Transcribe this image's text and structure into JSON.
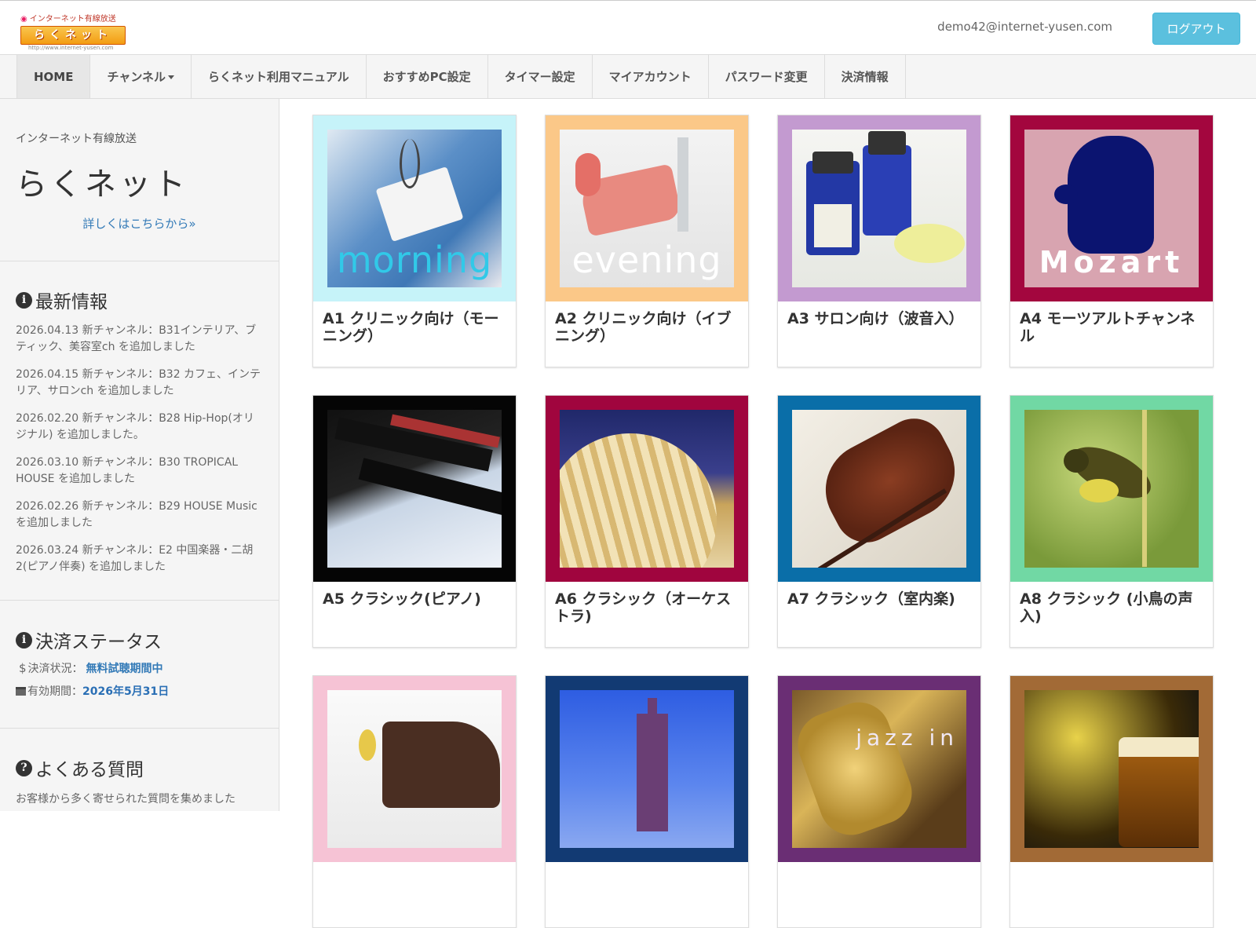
{
  "header": {
    "logo_top": "インターネット有線放送",
    "logo_main": "らくネット",
    "logo_url": "http://www.internet-yusen.com",
    "user_email": "demo42@internet-yusen.com",
    "logout_label": "ログアウト"
  },
  "nav": {
    "items": [
      {
        "label": "HOME"
      },
      {
        "label": "チャンネル"
      },
      {
        "label": "らくネット利用マニュアル"
      },
      {
        "label": "おすすめPC設定"
      },
      {
        "label": "タイマー設定"
      },
      {
        "label": "マイアカウント"
      },
      {
        "label": "パスワード変更"
      },
      {
        "label": "決済情報"
      }
    ]
  },
  "sidebar": {
    "intro_small": "インターネット有線放送",
    "brand": "らくネット",
    "more_link": "詳しくはこちらから»",
    "news_heading": "最新情報",
    "news": [
      "2026.04.13 新チャンネル：B31インテリア、ブティック、美容室ch を追加しました",
      "2026.04.15 新チャンネル：B32 カフェ、インテリア、サロンch を追加しました",
      "2026.02.20 新チャンネル：B28 Hip-Hop(オリジナル) を追加しました。",
      "2026.03.10 新チャンネル：B30 TROPICAL HOUSE を追加しました",
      "2026.02.26 新チャンネル：B29 HOUSE Music を追加しました",
      "2026.03.24 新チャンネル：E2 中国楽器・二胡2(ピアノ伴奏) を追加しました"
    ],
    "pay_heading": "決済ステータス",
    "pay_status_label": "決済状況：",
    "pay_status_value": "無料試聴期間中",
    "expiry_label": "有効期間：",
    "expiry_value": "2026年5月31日",
    "faq_heading": "よくある質問",
    "faq_text": "お客様から多く寄せられた質問を集めました"
  },
  "channels": [
    {
      "title": "A1 クリニック向け（モーニング）",
      "overlay": "morning",
      "frame_color": "#c6f3f9"
    },
    {
      "title": "A2 クリニック向け（イブニング）",
      "overlay": "evening",
      "frame_color": "#fbc888"
    },
    {
      "title": "A3 サロン向け（波音入）",
      "overlay": "",
      "frame_color": "#c39ad0"
    },
    {
      "title": "A4 モーツアルトチャンネル",
      "overlay": "Mozart",
      "frame_color": "#a3063e"
    },
    {
      "title": "A5 クラシック(ピアノ)",
      "overlay": "",
      "frame_color": "#050505"
    },
    {
      "title": "A6 クラシック（オーケストラ)",
      "overlay": "",
      "frame_color": "#a0053e"
    },
    {
      "title": "A7 クラシック（室内楽)",
      "overlay": "",
      "frame_color": "#0a6ea8"
    },
    {
      "title": "A8 クラシック (小鳥の声入)",
      "overlay": "",
      "frame_color": "#71d8a4"
    },
    {
      "title": "",
      "overlay": "",
      "frame_color": "#f6c3d5"
    },
    {
      "title": "",
      "overlay": "",
      "frame_color": "#123a73"
    },
    {
      "title": "",
      "overlay": "jazz in",
      "frame_color": "#6a2e74"
    },
    {
      "title": "",
      "overlay": "",
      "frame_color": "#a26a36"
    }
  ]
}
